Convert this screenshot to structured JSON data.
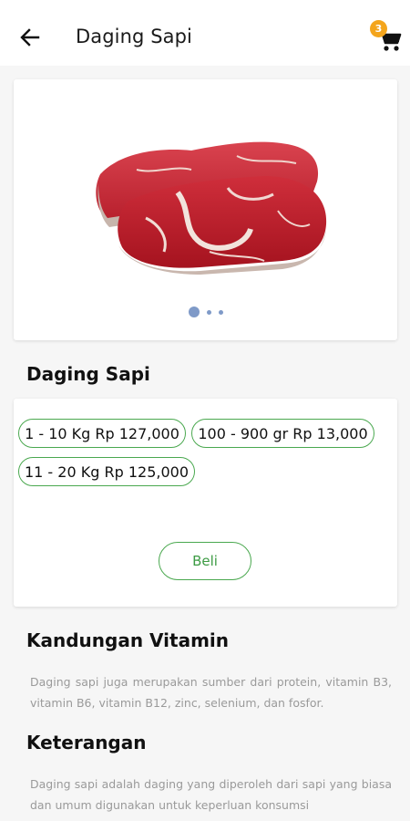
{
  "appbar": {
    "title": "Daging Sapi",
    "back_icon": "arrow-left-icon",
    "cart_icon": "shopping-cart-icon",
    "cart_count": "3"
  },
  "gallery": {
    "image": "beef-steak-image",
    "dot_count": 3,
    "active_dot": 0
  },
  "product": {
    "name": "Daging Sapi"
  },
  "prices": [
    {
      "label": "1 - 10 Kg Rp 127,000"
    },
    {
      "label": "100 - 900 gr Rp 13,000"
    },
    {
      "label": "11 - 20 Kg Rp 125,000"
    }
  ],
  "buy_label": "Beli",
  "vitamin": {
    "heading": "Kandungan Vitamin",
    "text": "Daging sapi juga merupakan sumber dari protein, vitamin B3, vitamin B6, vitamin B12, zinc, selenium, dan fosfor."
  },
  "keterangan": {
    "heading": "Keterangan",
    "text": "Daging sapi adalah daging yang diperoleh dari sapi yang biasa dan umum digunakan untuk keperluan konsumsi"
  },
  "colors": {
    "accent_green": "#4aa84f",
    "badge": "#f4a51c",
    "dot": "#7f9ac8"
  }
}
